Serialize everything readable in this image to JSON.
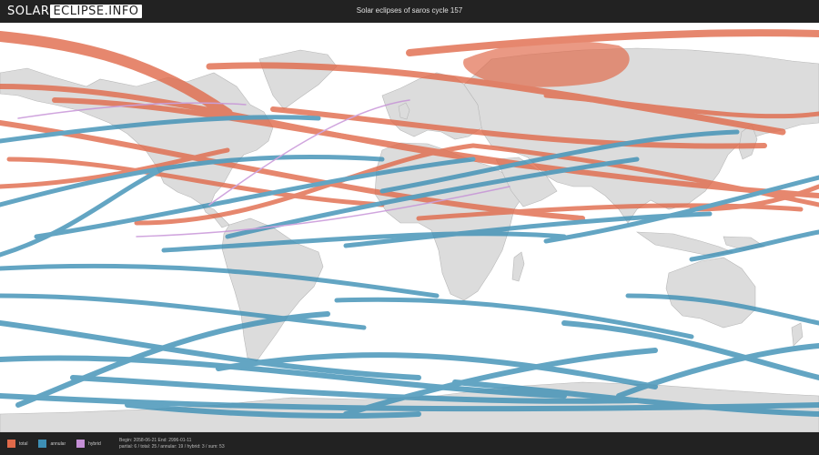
{
  "header": {
    "logo_left": "SOLAR",
    "logo_right": "ECLIPSE.INFO",
    "title": "Solar eclipses of saros cycle 157"
  },
  "colors": {
    "total": "#e06a4a",
    "annular": "#3d8fb5",
    "hybrid": "#c58fd6",
    "land": "#dcdcdc",
    "land_stroke": "#b8b8b8",
    "ocean": "#ffffff",
    "bar": "#222222"
  },
  "legend": [
    {
      "key": "total",
      "label": "total"
    },
    {
      "key": "annular",
      "label": "annular"
    },
    {
      "key": "hybrid",
      "label": "hybrid"
    }
  ],
  "stats": {
    "line1": "Begin: 2058-06-21 End: 2996-01-11",
    "line2": "partial: 6 / total: 25 / annular: 19 / hybrid: 3 / sum: 53"
  },
  "map": {
    "projection": "equirectangular",
    "path_types": [
      "total",
      "annular",
      "hybrid"
    ]
  }
}
